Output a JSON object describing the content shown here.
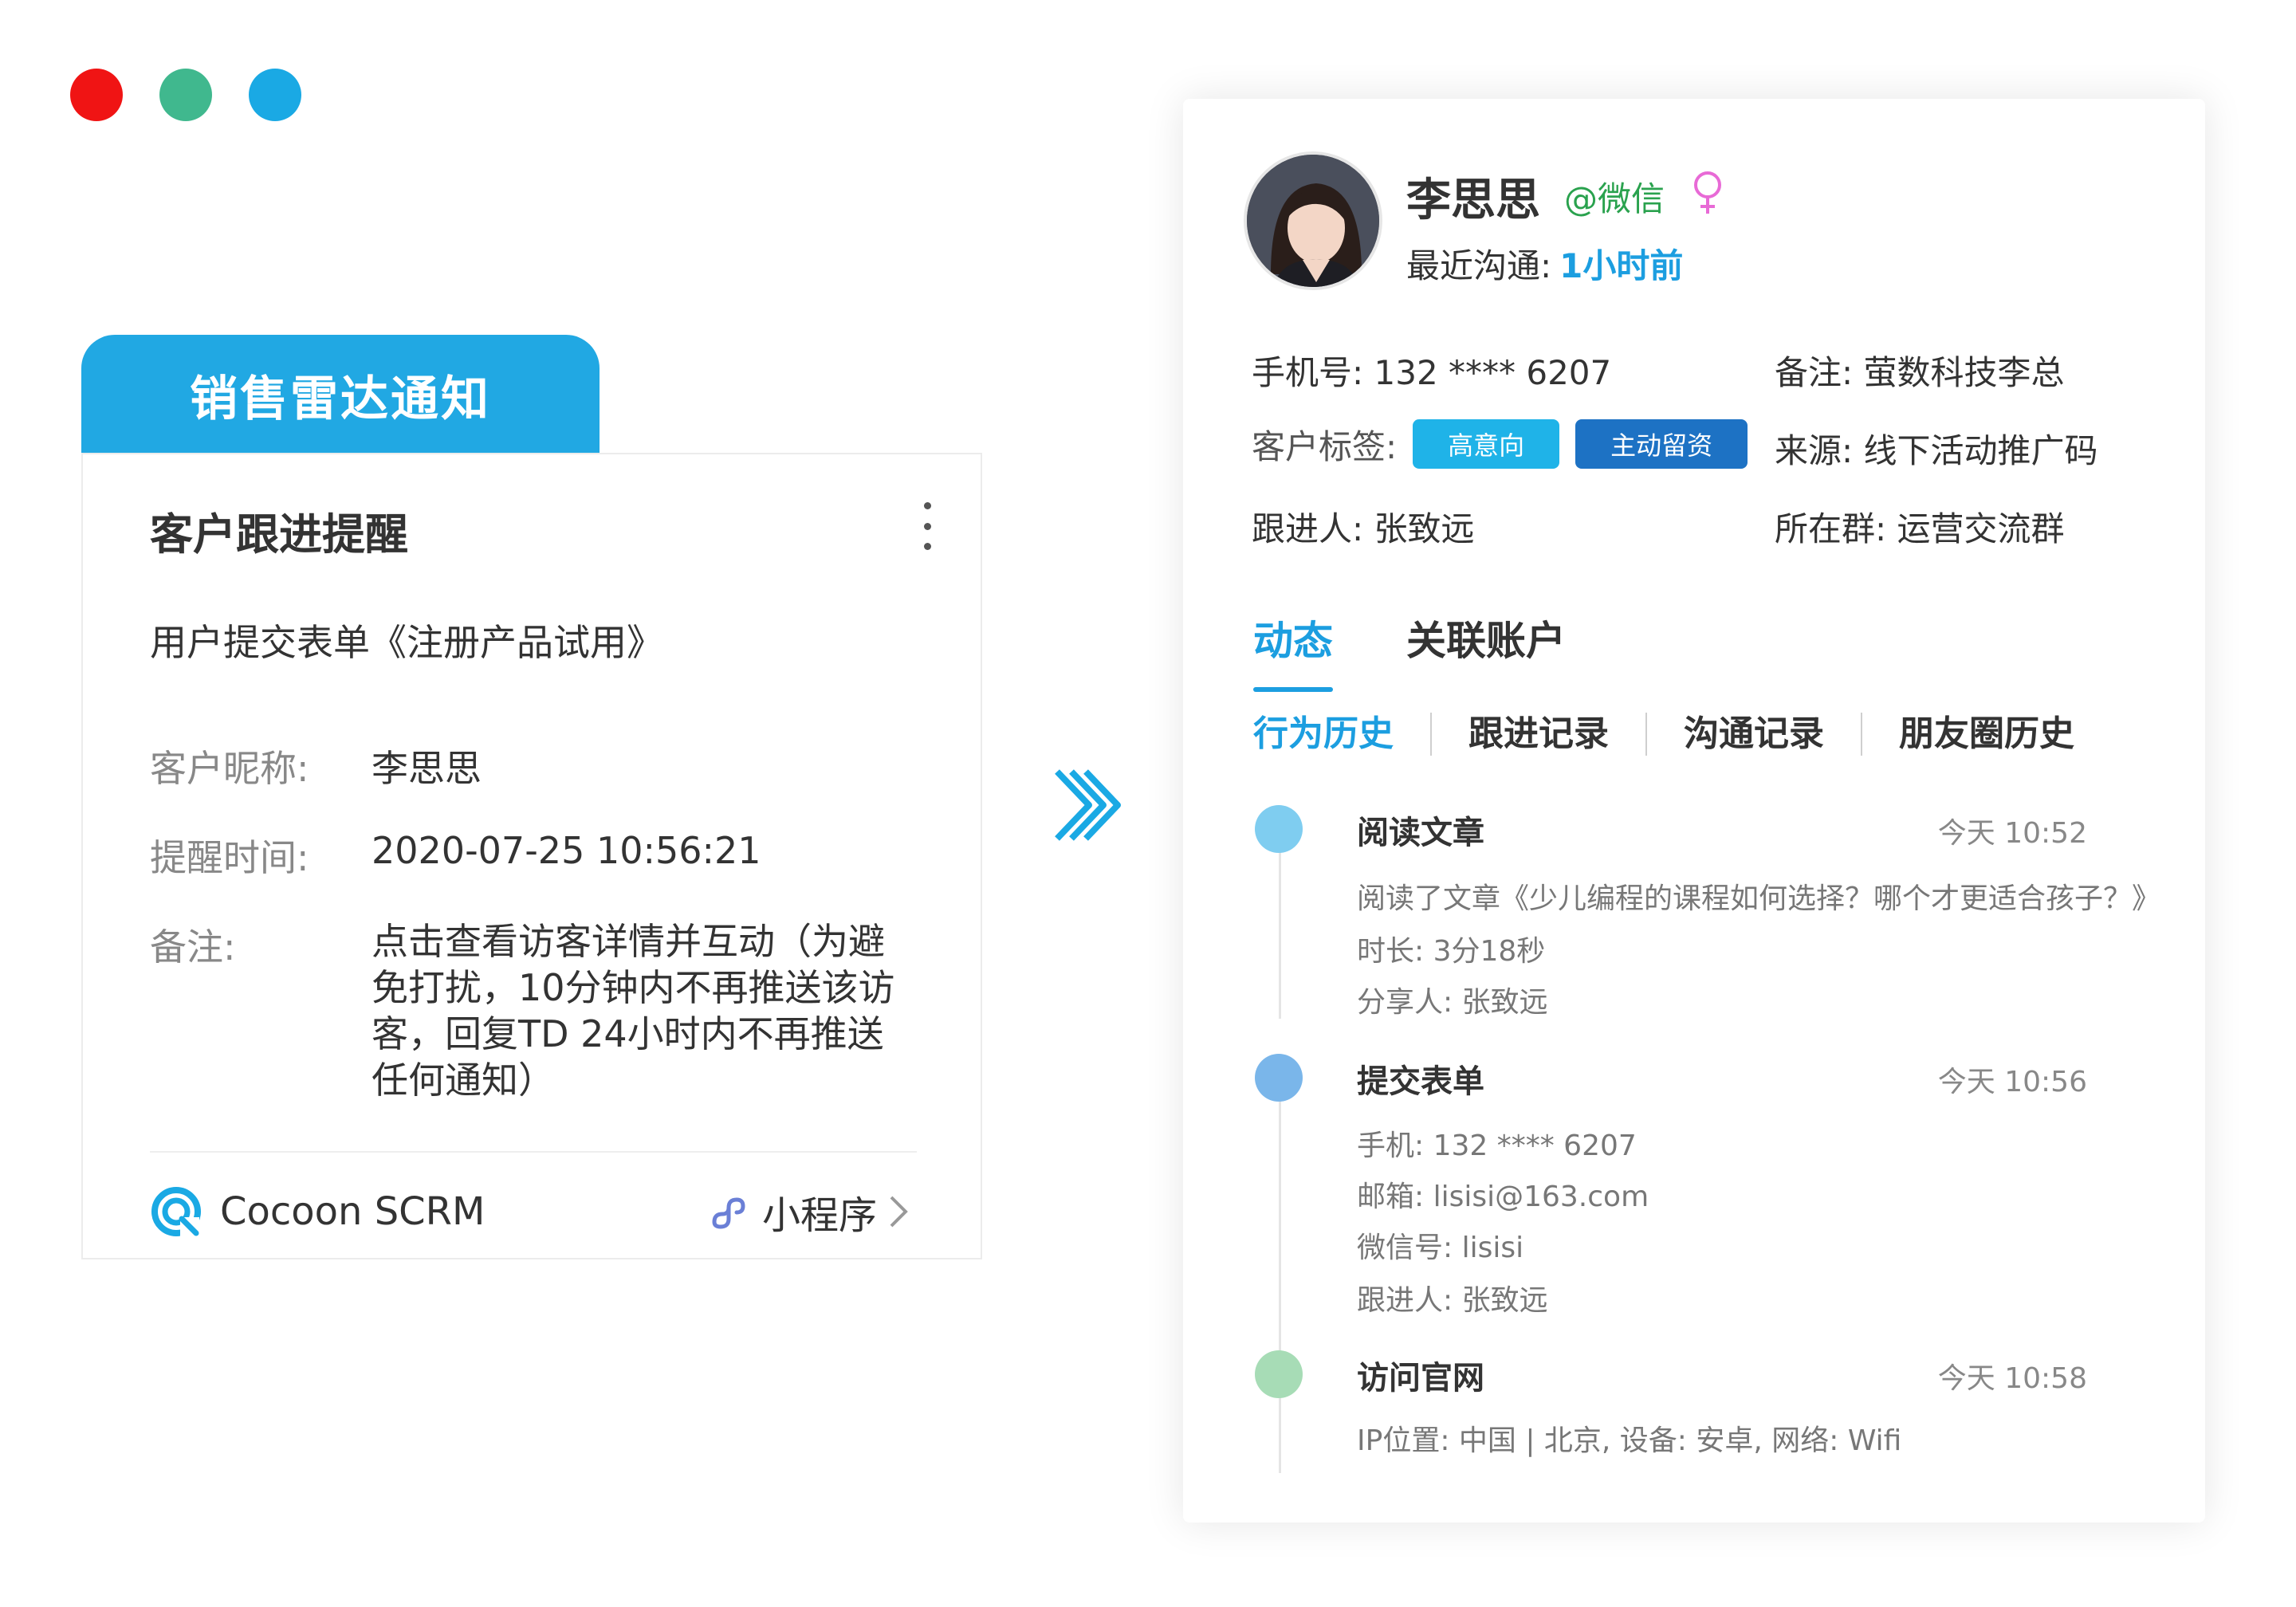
{
  "notification": {
    "tab_label": "销售雷达通知",
    "title": "客户跟进提醒",
    "subtitle": "用户提交表单《注册产品试用》",
    "fields": [
      {
        "label": "客户昵称:",
        "value": "李思思"
      },
      {
        "label": "提醒时间:",
        "value": "2020-07-25 10:56:21"
      },
      {
        "label": "备注:",
        "value": "点击查看访客详情并互动（为避免打扰，10分钟内不再推送该访客，回复TD 24小时内不再推送任何通知）"
      }
    ],
    "brand": "Cocoon SCRM",
    "mini_program": "小程序"
  },
  "profile": {
    "name": "李思思",
    "channel": "@微信",
    "gender_icon": "female-icon",
    "recent_label": "最近沟通:",
    "recent_value": "1小时前",
    "phone": "手机号: 132 **** 6207",
    "note": "备注: 萤数科技李总",
    "tags_label": "客户标签:",
    "tags": [
      "高意向",
      "主动留资"
    ],
    "source": "来源: 线下活动推广码",
    "follower": "跟进人: 张致远",
    "group": "所在群: 运营交流群"
  },
  "tabs": [
    "动态",
    "关联账户"
  ],
  "subtabs": [
    "行为历史",
    "跟进记录",
    "沟通记录",
    "朋友圈历史"
  ],
  "events": [
    {
      "title": "阅读文章",
      "time": "今天  10:52",
      "lines": [
        "阅读了文章《少儿编程的课程如何选择？哪个才更适合孩子？》",
        "时长: 3分18秒",
        "分享人: 张致远"
      ]
    },
    {
      "title": "提交表单",
      "time": "今天  10:56",
      "lines": [
        "手机: 132 **** 6207",
        "邮箱: lisisi@163.com",
        "微信号: lisisi",
        "跟进人: 张致远"
      ]
    },
    {
      "title": "访问官网",
      "time": "今天  10:58",
      "lines": [
        "IP位置: 中国 | 北京, 设备: 安卓, 网络: Wifi"
      ]
    }
  ],
  "colors": {
    "accent": "#1c9ee0",
    "tab_bg": "#21a8e3",
    "wechat": "#2aa24e",
    "tag_light": "#1fb3e8",
    "tag_dark": "#1d72c4"
  }
}
